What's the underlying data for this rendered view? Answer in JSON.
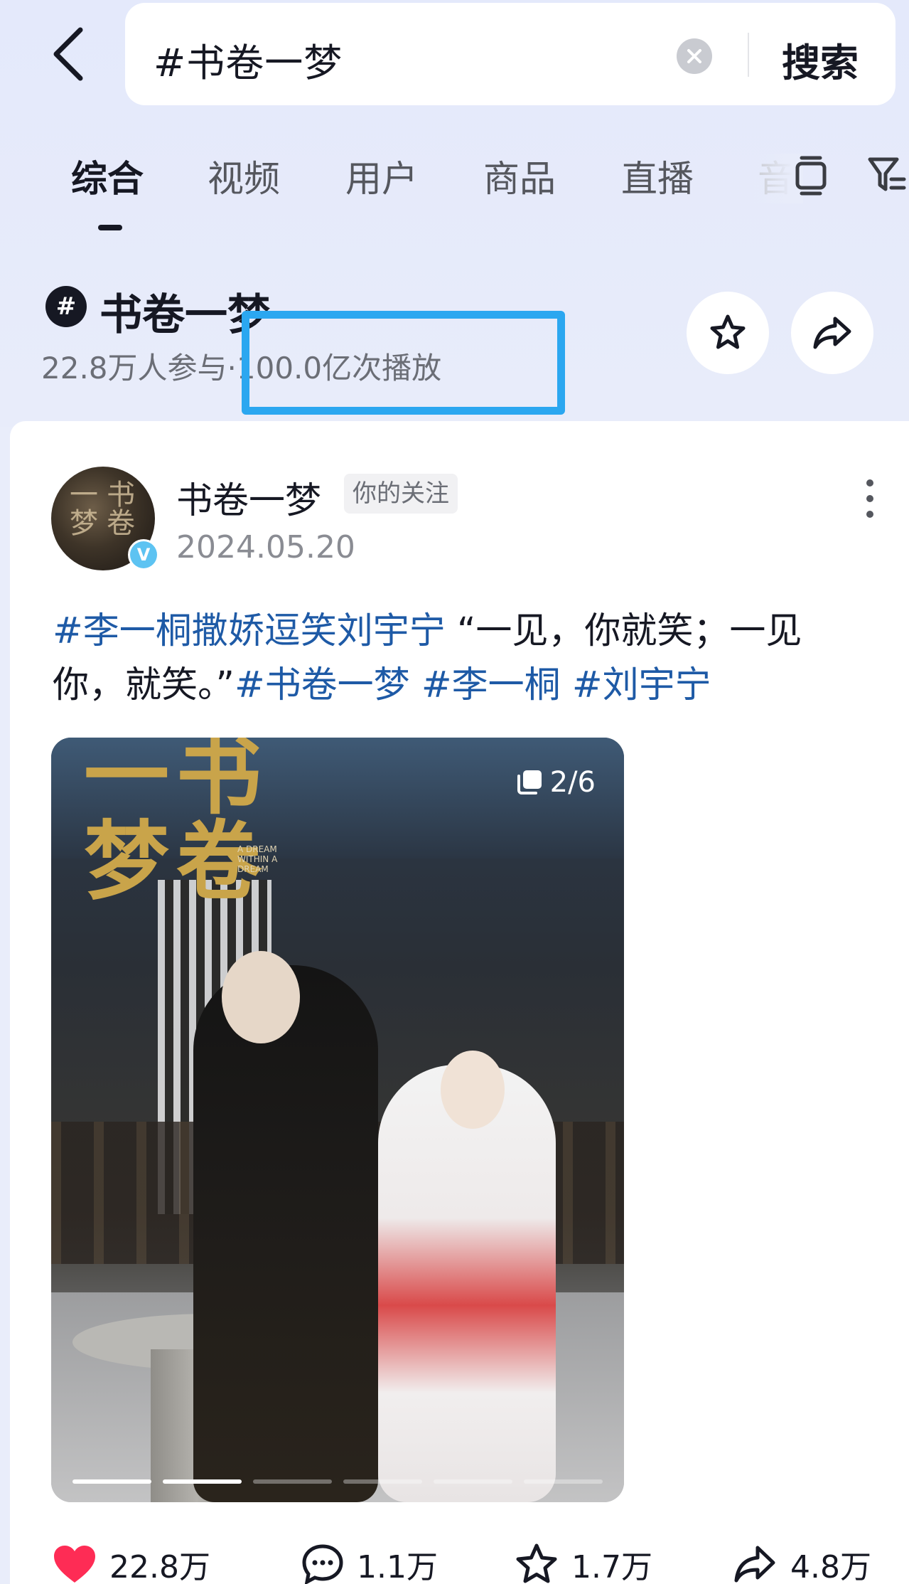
{
  "search": {
    "query": "#书卷一梦",
    "button_label": "搜索"
  },
  "tabs": [
    {
      "label": "综合",
      "active": true
    },
    {
      "label": "视频",
      "active": false
    },
    {
      "label": "用户",
      "active": false
    },
    {
      "label": "商品",
      "active": false
    },
    {
      "label": "直播",
      "active": false
    },
    {
      "label": "音",
      "active": false
    }
  ],
  "topic": {
    "hash_symbol": "#",
    "title": "书卷一梦",
    "participants": "22.8万人参与",
    "separator": "·",
    "plays": "100.0亿次播放"
  },
  "post": {
    "author": "书卷一梦",
    "follow_tag": "你的关注",
    "date": "2024.05.20",
    "verified_mark": "V",
    "caption_tag1": "#李一桐撒娇逗笑刘宇宁",
    "caption_text": " “一见，你就笑；一见你，就笑。”",
    "caption_tag2": "#书卷一梦",
    "caption_tag3": "#李一桐",
    "caption_tag4": "#刘宇宁",
    "media": {
      "page_indicator": "2/6",
      "calligraphy": "书卷一梦",
      "subtitle": "A DREAM WITHIN A DREAM",
      "current_page": 2,
      "total_pages": 6
    },
    "stats": {
      "likes": "22.8万",
      "comments": "1.1万",
      "favorites": "1.7万",
      "shares": "4.8万"
    }
  },
  "colors": {
    "accent_annotation": "#2ba7f0",
    "hashtag": "#1e5aa6",
    "like_red": "#fe2c55",
    "background": "#e9edfa"
  },
  "icons": {
    "back": "chevron-left-icon",
    "clear": "clear-icon",
    "layout": "layout-icon",
    "filter": "filter-icon",
    "favorite": "star-icon",
    "share": "share-icon",
    "more": "more-vertical-icon",
    "like": "heart-icon",
    "comment": "comment-icon",
    "gallery": "gallery-icon"
  }
}
